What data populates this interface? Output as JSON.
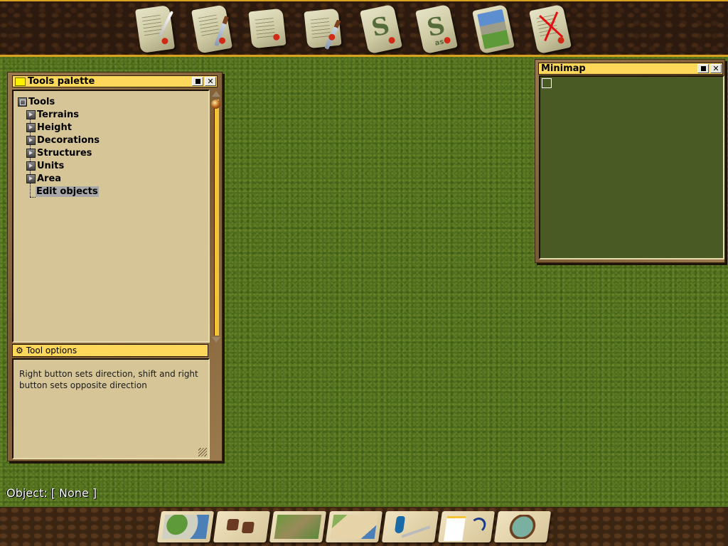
{
  "top_toolbar": {
    "buttons": [
      {
        "id": "new-map",
        "icon": "scroll-quill-icon"
      },
      {
        "id": "new-scenario",
        "icon": "scroll-dagger-icon"
      },
      {
        "id": "load-map",
        "icon": "rolled-scroll-icon"
      },
      {
        "id": "load-scenario",
        "icon": "rolled-scroll-dagger-icon"
      },
      {
        "id": "save",
        "icon": "save-scroll-icon",
        "glyph": "S",
        "sub": ""
      },
      {
        "id": "save-as",
        "icon": "save-as-scroll-icon",
        "glyph": "S",
        "sub": "as"
      },
      {
        "id": "map-preview",
        "icon": "stonehenge-picture-icon"
      },
      {
        "id": "exit",
        "icon": "crossed-scroll-icon"
      }
    ]
  },
  "tools_palette": {
    "title": "Tools palette",
    "tree": {
      "root": "Tools",
      "items": [
        {
          "label": "Terrains",
          "expandable": true
        },
        {
          "label": "Height",
          "expandable": true
        },
        {
          "label": "Decorations",
          "expandable": true
        },
        {
          "label": "Structures",
          "expandable": true
        },
        {
          "label": "Units",
          "expandable": true
        },
        {
          "label": "Area",
          "expandable": true
        },
        {
          "label": "Edit objects",
          "expandable": false,
          "selected": true
        }
      ]
    },
    "tool_options": {
      "title": "Tool options",
      "text": "Right button sets direction, shift and right button sets opposite direction"
    }
  },
  "minimap": {
    "title": "Minimap",
    "background_color": "#4a5a24"
  },
  "status": {
    "object_label": "Object: [ None ]"
  },
  "bottom_toolbar": {
    "buttons": [
      {
        "id": "map-overview",
        "icon": "map-icon"
      },
      {
        "id": "random",
        "icon": "dice-icon"
      },
      {
        "id": "terrain-editor",
        "icon": "terrain-brush-icon"
      },
      {
        "id": "map-properties",
        "icon": "map-scroll-icon"
      },
      {
        "id": "scripting",
        "icon": "ink-quill-icon"
      },
      {
        "id": "dialogs",
        "icon": "dialog-swap-icon"
      },
      {
        "id": "view",
        "icon": "magnifier-globe-icon"
      }
    ]
  },
  "colors": {
    "title_bar": "#fdd85b",
    "panel_bg": "#d6c597",
    "grass": "#4e6e1e",
    "frame_gold": "#d7a21f"
  }
}
